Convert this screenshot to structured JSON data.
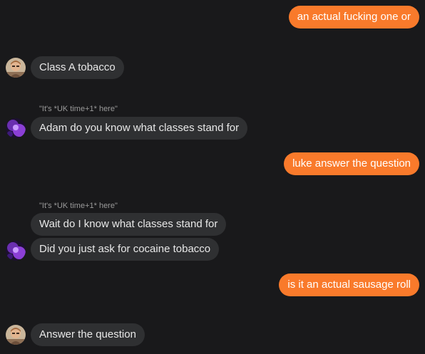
{
  "colors": {
    "background": "#19191b",
    "outgoing_bubble": "#f97a2b",
    "incoming_bubble": "#2f3032",
    "incoming_text": "#e8e8e8",
    "reply_note_text": "#9a9a9a"
  },
  "messages": [
    {
      "direction": "outgoing",
      "text": "an actual fucking one or"
    },
    {
      "direction": "incoming",
      "sender_avatar": "avatar-photo-man",
      "text": "Class A tobacco"
    },
    {
      "direction": "incoming",
      "sender_avatar": "avatar-purple",
      "reply_note": "\"It's *UK time+1* here\"",
      "text": "Adam do you know what classes stand for"
    },
    {
      "direction": "outgoing",
      "text": "luke answer the question"
    },
    {
      "direction": "incoming",
      "sender_avatar": "avatar-purple",
      "reply_note": "\"It's *UK time+1* here\"",
      "text": "Wait do I know what classes stand for"
    },
    {
      "direction": "incoming",
      "sender_avatar": "avatar-purple",
      "text": "Did you just ask for cocaine tobacco"
    },
    {
      "direction": "outgoing",
      "text": "is it an actual sausage roll"
    },
    {
      "direction": "incoming",
      "sender_avatar": "avatar-photo-man",
      "text": "Answer the question"
    }
  ]
}
